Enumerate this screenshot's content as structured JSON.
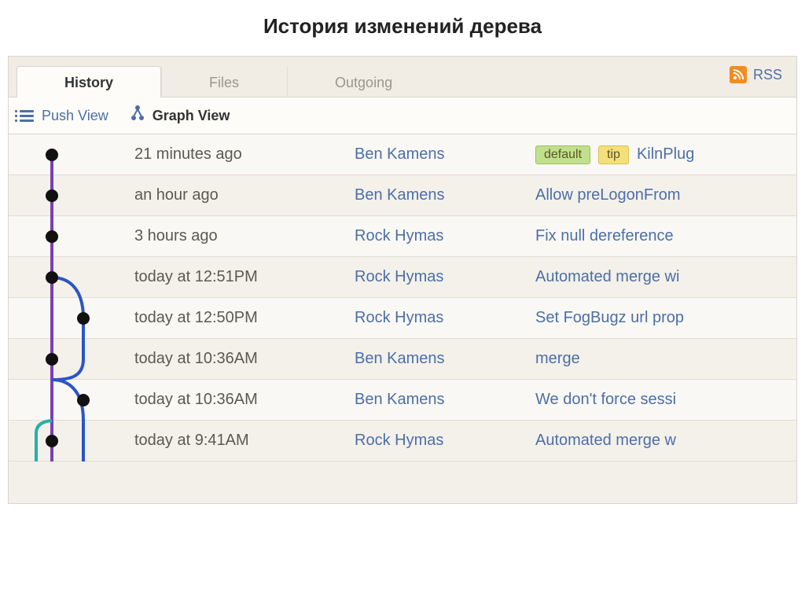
{
  "page_title": "История изменений дерева",
  "tabs": {
    "history": "History",
    "files": "Files",
    "outgoing": "Outgoing"
  },
  "rss_label": "RSS",
  "views": {
    "push": "Push View",
    "graph": "Graph View"
  },
  "badges": {
    "default": "default",
    "tip": "tip"
  },
  "commits": [
    {
      "time": "21 minutes ago",
      "author": "Ben Kamens",
      "message": "KilnPlug",
      "badges": [
        "default",
        "tip"
      ]
    },
    {
      "time": "an hour ago",
      "author": "Ben Kamens",
      "message": "Allow preLogonFrom",
      "badges": []
    },
    {
      "time": "3 hours ago",
      "author": "Rock Hymas",
      "message": "Fix null dereference",
      "badges": []
    },
    {
      "time": "today at 12:51PM",
      "author": "Rock Hymas",
      "message": "Automated merge wi",
      "badges": []
    },
    {
      "time": "today at 12:50PM",
      "author": "Rock Hymas",
      "message": "Set FogBugz url prop",
      "badges": []
    },
    {
      "time": "today at 10:36AM",
      "author": "Ben Kamens",
      "message": "merge",
      "badges": []
    },
    {
      "time": "today at 10:36AM",
      "author": "Ben Kamens",
      "message": "We don't force sessi",
      "badges": []
    },
    {
      "time": "today at 9:41AM",
      "author": "Rock Hymas",
      "message": "Automated merge w",
      "badges": []
    }
  ]
}
